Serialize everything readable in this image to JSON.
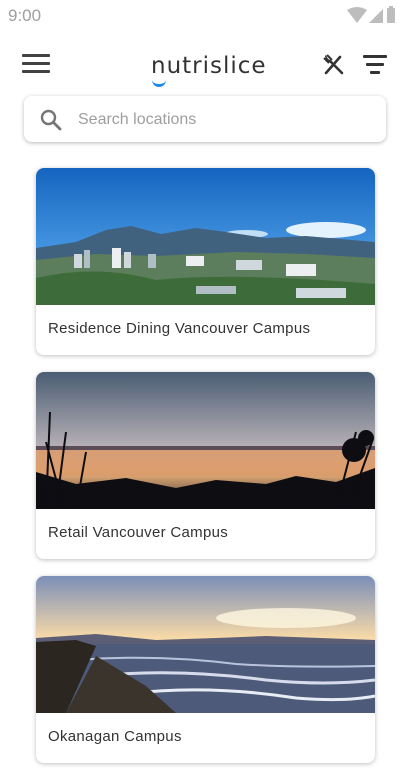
{
  "status_bar": {
    "time": "9:00"
  },
  "app_bar": {
    "logo_text": "nutrislice"
  },
  "search": {
    "placeholder": "Search locations",
    "value": ""
  },
  "locations": [
    {
      "name": "Residence Dining Vancouver Campus"
    },
    {
      "name": "Retail Vancouver Campus"
    },
    {
      "name": "Okanagan Campus"
    }
  ],
  "colors": {
    "accent": "#1e88e5",
    "text": "#333333",
    "placeholder": "#9e9e9e"
  }
}
